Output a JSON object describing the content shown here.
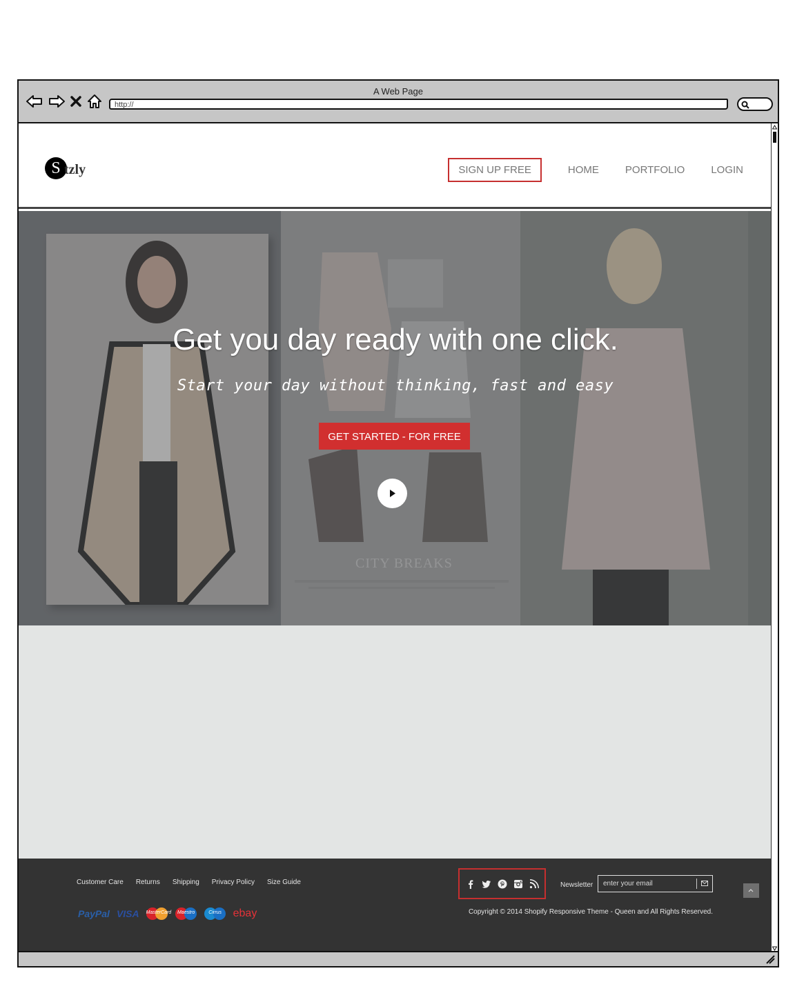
{
  "window": {
    "title": "A Web Page",
    "address": "http://"
  },
  "header": {
    "logo_letter": "S",
    "logo_text": "tzly",
    "nav": [
      {
        "label": "SIGN UP FREE"
      },
      {
        "label": "HOME"
      },
      {
        "label": "PORTFOLIO"
      },
      {
        "label": "LOGIN"
      }
    ]
  },
  "hero": {
    "headline": "Get you day ready with one click.",
    "subheadline": "Start your day without thinking, fast and easy",
    "cta_label": "GET STARTED - FOR FREE",
    "faint_caption": "CITY BREAKS"
  },
  "footer": {
    "links": [
      "Customer Care",
      "Returns",
      "Shipping",
      "Privacy Policy",
      "Size Guide"
    ],
    "payments": [
      "PayPal",
      "VISA",
      "MasterCard",
      "Maestro",
      "Cirrus",
      "ebay"
    ],
    "social_icons": [
      "facebook-icon",
      "twitter-icon",
      "pinterest-icon",
      "instagram-icon",
      "rss-icon"
    ],
    "newsletter_label": "Newsletter",
    "newsletter_placeholder": "enter your email",
    "copyright": "Copyright © 2014 Shopify Responsive Theme - Queen and All Rights Reserved."
  },
  "colors": {
    "accent": "#d12f2f",
    "footer_bg": "#333333",
    "body_bg": "#e3e5e4"
  }
}
